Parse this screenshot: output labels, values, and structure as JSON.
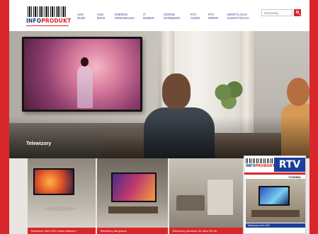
{
  "header": {
    "logo": {
      "part1": "INFO",
      "part2": "PRODUKT"
    },
    "nav": [
      {
        "line1": "AGD",
        "line2": "DUŻE"
      },
      {
        "line1": "AGD",
        "line2": "MAŁE"
      },
      {
        "line1": "ENERGIA",
        "line2": "ODNAWIALNA"
      },
      {
        "line1": "IT",
        "line2": "MOBILE"
      },
      {
        "line1": "OGRÓD",
        "line2": "NARZĘDZIA"
      },
      {
        "line1": "RTV",
        "line2": "AUDIO"
      },
      {
        "line1": "RTV",
        "line2": "WIDEO"
      },
      {
        "line1": "WENTYLACJA",
        "line2": "KLIMATYZACJA"
      }
    ],
    "search": {
      "placeholder": "Wyszukaj..."
    }
  },
  "hero": {
    "section_title": "Telewizory"
  },
  "products": [
    {
      "caption": "Telewizory mini-LED czasz większe r"
    },
    {
      "caption": "Telewizory dla graczy"
    },
    {
      "caption": "Telewizory premium 4K Ultra HD do"
    }
  ],
  "magazine": {
    "logo": {
      "part1": "INFO",
      "part2": "PRODUKT"
    },
    "title": "RTV",
    "brand": "TOSHIBA",
    "cover_caption": "Telewizory mini-LED"
  },
  "colors": {
    "brand_red": "#d9262b",
    "brand_blue": "#1a3b8a",
    "nav_text": "#3a3aa0"
  }
}
